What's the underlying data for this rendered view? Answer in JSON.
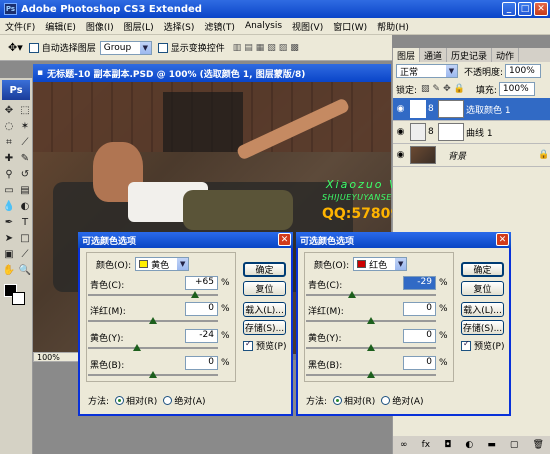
{
  "app": {
    "title": "Adobe Photoshop CS3 Extended"
  },
  "menu": [
    "文件(F)",
    "编辑(E)",
    "图像(I)",
    "图层(L)",
    "选择(S)",
    "滤镜(T)",
    "Analysis",
    "视图(V)",
    "窗口(W)",
    "帮助(H)"
  ],
  "options": {
    "auto_select": "自动选择图层",
    "group_value": "Group",
    "show_transform": "显示变换控件"
  },
  "document": {
    "title": "无标题-10 副本副本.PSD @ 100% (选取颜色 1, 图层蒙版/8)",
    "zoom": "100%"
  },
  "watermark": {
    "line1": "Xiaozuo Vision",
    "line2": "SHIJUEYUYANSEDECHONGJI",
    "line3": "QQ:578094297"
  },
  "layers_panel": {
    "tabs": [
      "图层",
      "通道",
      "历史记录",
      "动作"
    ],
    "blend_mode": "正常",
    "opacity_label": "不透明度:",
    "opacity": "100%",
    "lock_label": "锁定:",
    "fill_label": "填充:",
    "fill": "100%",
    "layers": [
      {
        "name": "选取颜色 1",
        "active": true
      },
      {
        "name": "曲线 1",
        "active": false
      },
      {
        "name": "背景",
        "active": false
      }
    ]
  },
  "dialog_yellow": {
    "title": "可选颜色选项",
    "color_label": "颜色(O):",
    "color": "黄色",
    "swatch": "#ffee00",
    "sliders": [
      {
        "label": "青色(C):",
        "value": "+65",
        "level": 0.825
      },
      {
        "label": "洋红(M):",
        "value": "0",
        "level": 0.5
      },
      {
        "label": "黄色(Y):",
        "value": "-24",
        "level": 0.38
      },
      {
        "label": "黑色(B):",
        "value": "0",
        "level": 0.5
      }
    ],
    "buttons": {
      "ok": "确定",
      "reset": "复位",
      "load": "载入(L)...",
      "save": "存储(S)..."
    },
    "preview": "预览(P)",
    "method_label": "方法:",
    "relative": "相对(R)",
    "absolute": "绝对(A)"
  },
  "dialog_red": {
    "title": "可选颜色选项",
    "color_label": "颜色(O):",
    "color": "红色",
    "swatch": "#cc0000",
    "sliders": [
      {
        "label": "青色(C):",
        "value": "-29",
        "level": 0.355
      },
      {
        "label": "洋红(M):",
        "value": "0",
        "level": 0.5
      },
      {
        "label": "黄色(Y):",
        "value": "0",
        "level": 0.5
      },
      {
        "label": "黑色(B):",
        "value": "0",
        "level": 0.5
      }
    ],
    "buttons": {
      "ok": "确定",
      "reset": "复位",
      "load": "载入(L)...",
      "save": "存储(S)..."
    },
    "preview": "预览(P)",
    "method_label": "方法:",
    "relative": "相对(R)",
    "absolute": "绝对(A)"
  }
}
